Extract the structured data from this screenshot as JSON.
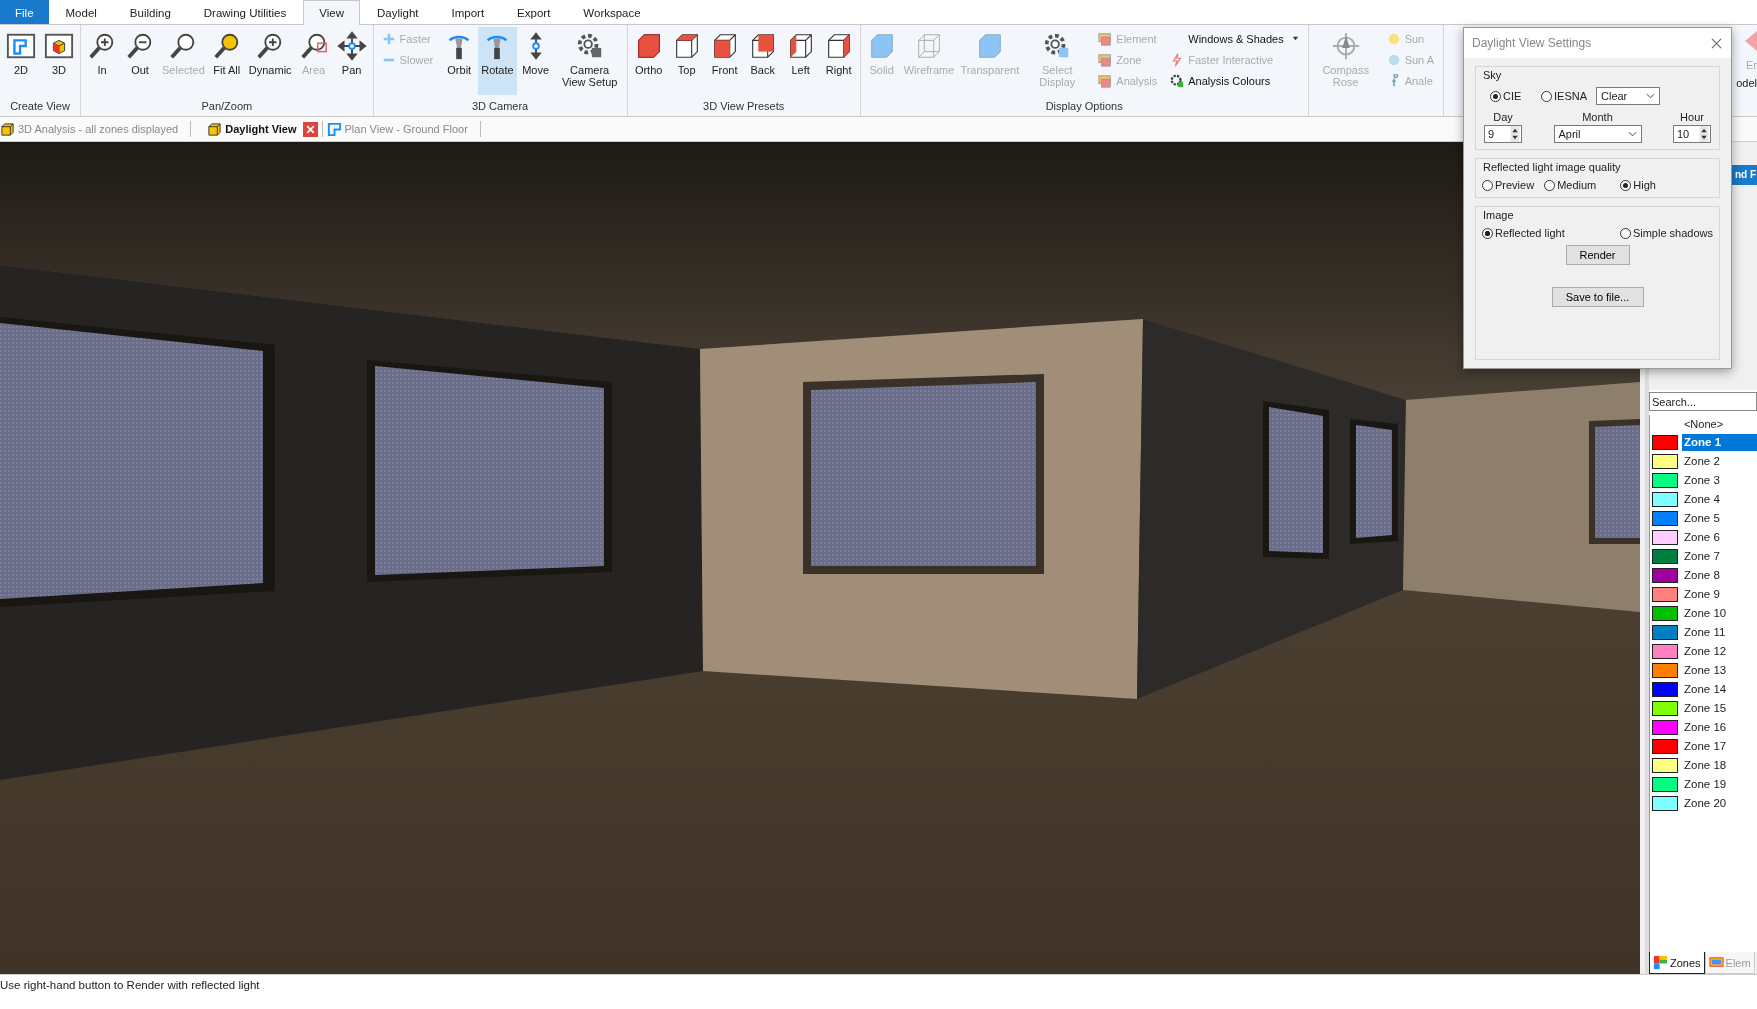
{
  "menu_tabs": [
    {
      "label": "File",
      "kind": "file",
      "selected": false
    },
    {
      "label": "Model",
      "kind": "tab",
      "selected": false
    },
    {
      "label": "Building",
      "kind": "tab",
      "selected": false
    },
    {
      "label": "Drawing Utilities",
      "kind": "tab",
      "selected": false
    },
    {
      "label": "View",
      "kind": "tab",
      "selected": true
    },
    {
      "label": "Daylight",
      "kind": "tab",
      "selected": false
    },
    {
      "label": "Import",
      "kind": "tab",
      "selected": false
    },
    {
      "label": "Export",
      "kind": "tab",
      "selected": false
    },
    {
      "label": "Workspace",
      "kind": "tab",
      "selected": false
    }
  ],
  "ribbon": {
    "groups": [
      {
        "label": "Create View",
        "items": [
          {
            "kind": "large",
            "label": "2D",
            "disabled": false,
            "selected": false
          },
          {
            "kind": "large",
            "label": "3D",
            "disabled": false,
            "selected": false
          }
        ]
      },
      {
        "label": "Pan/Zoom",
        "items": [
          {
            "kind": "large",
            "label": "In",
            "disabled": false,
            "selected": false
          },
          {
            "kind": "large",
            "label": "Out",
            "disabled": false,
            "selected": false
          },
          {
            "kind": "large",
            "label": "Selected",
            "disabled": true,
            "selected": false
          },
          {
            "kind": "large",
            "label": "Fit All",
            "disabled": false,
            "selected": false
          },
          {
            "kind": "large",
            "label": "Dynamic",
            "disabled": false,
            "selected": false
          },
          {
            "kind": "large",
            "label": "Area",
            "disabled": true,
            "selected": false
          },
          {
            "kind": "large",
            "label": "Pan",
            "disabled": false,
            "selected": false
          }
        ]
      },
      {
        "label": "3D Camera",
        "items": [
          {
            "kind": "stack",
            "children": [
              {
                "label": "Faster",
                "disabled": true
              },
              {
                "label": "Slower",
                "disabled": true
              }
            ]
          },
          {
            "kind": "large",
            "label": "Orbit",
            "disabled": false,
            "selected": false
          },
          {
            "kind": "large",
            "label": "Rotate",
            "disabled": false,
            "selected": true
          },
          {
            "kind": "large",
            "label": "Move",
            "disabled": false,
            "selected": false
          },
          {
            "kind": "large",
            "label": "Camera View Setup",
            "disabled": false,
            "selected": false
          }
        ]
      },
      {
        "label": "3D View Presets",
        "items": [
          {
            "kind": "large",
            "label": "Ortho",
            "disabled": false,
            "selected": false
          },
          {
            "kind": "large",
            "label": "Top",
            "disabled": false,
            "selected": false
          },
          {
            "kind": "large",
            "label": "Front",
            "disabled": false,
            "selected": false
          },
          {
            "kind": "large",
            "label": "Back",
            "disabled": false,
            "selected": false
          },
          {
            "kind": "large",
            "label": "Left",
            "disabled": false,
            "selected": false
          },
          {
            "kind": "large",
            "label": "Right",
            "disabled": false,
            "selected": false
          }
        ]
      },
      {
        "label": "Display Options",
        "items": [
          {
            "kind": "large",
            "label": "Solid",
            "disabled": true,
            "selected": false
          },
          {
            "kind": "large",
            "label": "Wireframe",
            "disabled": true,
            "selected": false
          },
          {
            "kind": "large",
            "label": "Transparent",
            "disabled": true,
            "selected": false
          },
          {
            "kind": "large",
            "label": "Select Display",
            "disabled": true,
            "selected": false
          },
          {
            "kind": "stack",
            "children": [
              {
                "label": "Element",
                "disabled": true
              },
              {
                "label": "Zone",
                "disabled": true
              },
              {
                "label": "Analysis",
                "disabled": true
              }
            ]
          },
          {
            "kind": "stack",
            "children": [
              {
                "label": "Windows & Shades",
                "disabled": false,
                "dropdown": true
              },
              {
                "label": "Faster Interactive",
                "disabled": true
              },
              {
                "label": "Analysis Colours",
                "disabled": false
              }
            ]
          }
        ]
      },
      {
        "items": [
          {
            "kind": "large",
            "label": "Compass Rose",
            "disabled": true,
            "selected": false
          },
          {
            "kind": "stack",
            "children": [
              {
                "label": "Sun",
                "disabled": true
              },
              {
                "label": "Sun A",
                "disabled": true
              },
              {
                "label": "Anale",
                "disabled": true
              }
            ]
          }
        ]
      }
    ]
  },
  "doc_tabs": [
    {
      "label": "3D Analysis - all zones displayed",
      "selected": false
    },
    {
      "label": "Daylight View",
      "selected": true
    },
    {
      "label": "Plan View - Ground Floor",
      "selected": false
    }
  ],
  "right_panel": {
    "ribbon_fragment": "Er",
    "group_fragment": "odel",
    "header_fragment": "nd F",
    "search": {
      "placeholder": "Search..."
    },
    "none_item": "<None>",
    "zones": [
      {
        "name": "Zone 1",
        "color": "#ff0000",
        "selected": true
      },
      {
        "name": "Zone 2",
        "color": "#ffff80",
        "selected": false
      },
      {
        "name": "Zone 3",
        "color": "#00ff80",
        "selected": false
      },
      {
        "name": "Zone 4",
        "color": "#80ffff",
        "selected": false
      },
      {
        "name": "Zone 5",
        "color": "#0080ff",
        "selected": false
      },
      {
        "name": "Zone 6",
        "color": "#ffccff",
        "selected": false
      },
      {
        "name": "Zone 7",
        "color": "#008040",
        "selected": false
      },
      {
        "name": "Zone 8",
        "color": "#a000a0",
        "selected": false
      },
      {
        "name": "Zone 9",
        "color": "#ff8080",
        "selected": false
      },
      {
        "name": "Zone 10",
        "color": "#00c000",
        "selected": false
      },
      {
        "name": "Zone 11",
        "color": "#0080c0",
        "selected": false
      },
      {
        "name": "Zone 12",
        "color": "#ff80c0",
        "selected": false
      },
      {
        "name": "Zone 13",
        "color": "#ff8000",
        "selected": false
      },
      {
        "name": "Zone 14",
        "color": "#0000ff",
        "selected": false
      },
      {
        "name": "Zone 15",
        "color": "#80ff00",
        "selected": false
      },
      {
        "name": "Zone 16",
        "color": "#ff00ff",
        "selected": false
      },
      {
        "name": "Zone 17",
        "color": "#ff0000",
        "selected": false
      },
      {
        "name": "Zone 18",
        "color": "#ffff80",
        "selected": false
      },
      {
        "name": "Zone 19",
        "color": "#00ff80",
        "selected": false
      },
      {
        "name": "Zone 20",
        "color": "#80ffff",
        "selected": false
      }
    ],
    "bottom_tabs": [
      {
        "label": "Zones",
        "selected": true
      },
      {
        "label": "Elem",
        "selected": false
      }
    ]
  },
  "dialog": {
    "title": "Daylight View Settings",
    "sky": {
      "label": "Sky",
      "options": [
        {
          "label": "CIE",
          "selected": true
        },
        {
          "label": "IESNA",
          "selected": false
        }
      ],
      "sky_type": "Clear",
      "day": {
        "label": "Day",
        "value": "9"
      },
      "month": {
        "label": "Month",
        "value": "April"
      },
      "hour": {
        "label": "Hour",
        "value": "10"
      }
    },
    "quality": {
      "label": "Reflected light image quality",
      "options": [
        {
          "label": "Preview",
          "selected": false
        },
        {
          "label": "Medium",
          "selected": false
        },
        {
          "label": "High",
          "selected": true
        }
      ]
    },
    "image": {
      "label": "Image",
      "options": [
        {
          "label": "Reflected light",
          "selected": true
        },
        {
          "label": "Simple shadows",
          "selected": false
        }
      ]
    },
    "render_button": "Render",
    "save_button": "Save to file..."
  },
  "status_bar": "Use right-hand button to Render with reflected light"
}
